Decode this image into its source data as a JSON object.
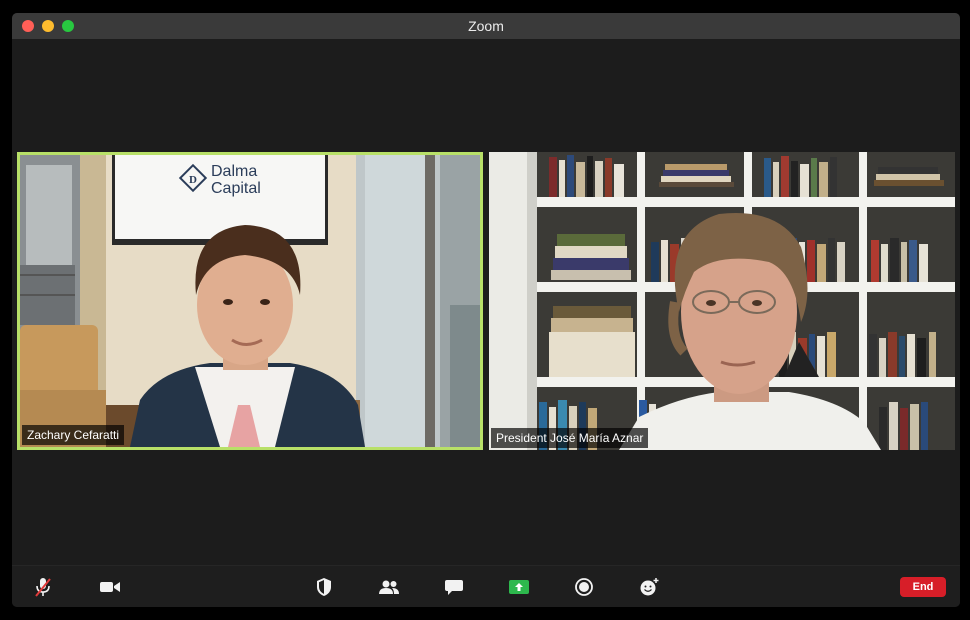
{
  "window": {
    "title": "Zoom"
  },
  "participants": [
    {
      "name": "Zachary Cefaratti",
      "active_speaker": true
    },
    {
      "name": "President José María Aznar",
      "active_speaker": false
    }
  ],
  "background_sign": {
    "line1": "Dalma",
    "line2": "Capital"
  },
  "toolbar": {
    "icons": [
      "microphone-muted-icon",
      "video-camera-icon",
      "security-shield-icon",
      "participants-icon",
      "chat-icon",
      "share-screen-icon",
      "record-icon",
      "reactions-icon"
    ],
    "end_label": "End",
    "accent": "#2db84d",
    "end_color": "#d71e28"
  }
}
